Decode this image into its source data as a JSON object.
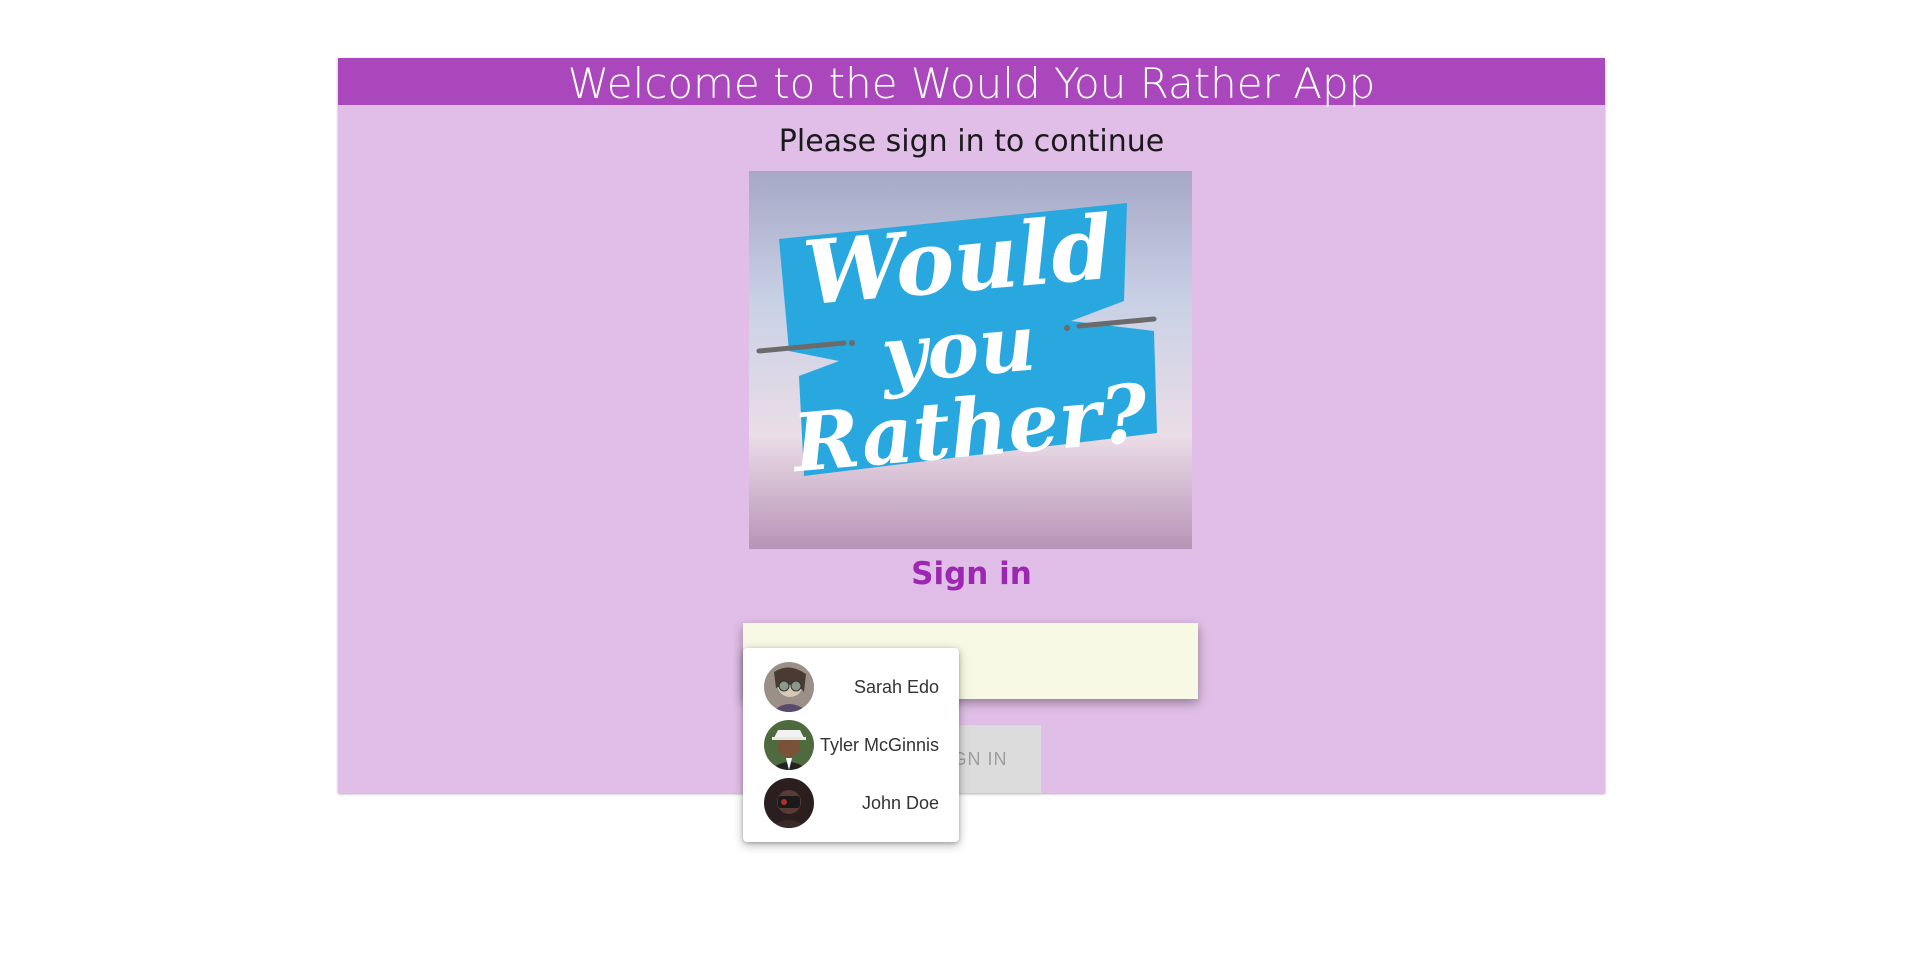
{
  "header": {
    "title": "Welcome to the Would You Rather App"
  },
  "main": {
    "subtitle": "Please sign in to continue",
    "logo_text": [
      "Would",
      "you",
      "Rather?"
    ],
    "signin_title": "Sign in",
    "signin_button_label": "SIGN IN"
  },
  "user_select": {
    "selected_value": "",
    "options": [
      {
        "label": "Sarah Edo"
      },
      {
        "label": "Tyler McGinnis"
      },
      {
        "label": "John Doe"
      }
    ]
  },
  "colors": {
    "header_bg": "#ab47bc",
    "card_bg": "#e1bee7",
    "accent_purple": "#9c27b0",
    "logo_blue": "#29a8e0"
  }
}
